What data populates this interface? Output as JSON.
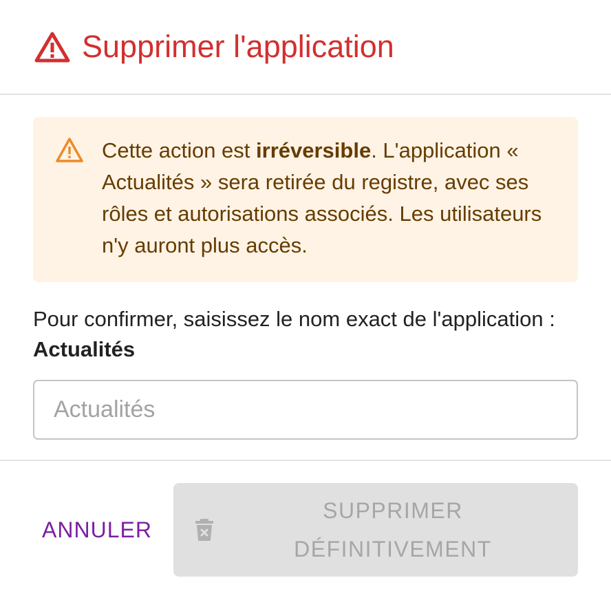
{
  "dialog": {
    "title": "Supprimer l'application",
    "title_icon": "warning-icon",
    "accent_color": "#d32f2f"
  },
  "alert": {
    "icon": "warning-icon",
    "text_before": "Cette action est ",
    "text_bold": "irréversible",
    "text_after": ". L'application « Actualités » sera retirée du registre, avec ses rôles et autorisations associés. Les utilisateurs n'y auront plus accès.",
    "background_color": "#fff3e5",
    "text_color": "#663c00"
  },
  "confirm": {
    "prompt": "Pour confirmer, saisissez le nom exact de l'application : ",
    "app_name": "Actualités"
  },
  "input": {
    "value": "",
    "placeholder": "Actualités"
  },
  "actions": {
    "cancel_label": "ANNULER",
    "cancel_color": "#7b1fa2",
    "delete_label": "SUPPRIMER DÉFINITIVEMENT",
    "delete_icon": "trash-icon",
    "delete_disabled": true
  }
}
